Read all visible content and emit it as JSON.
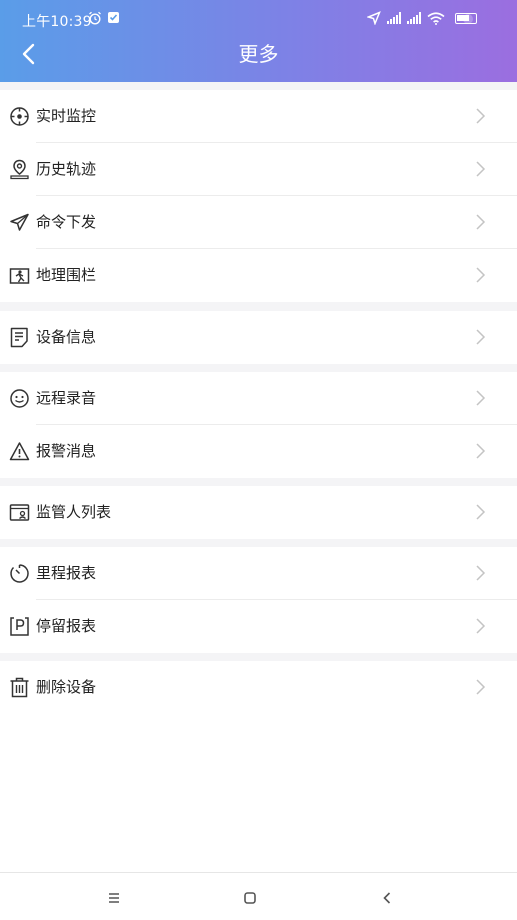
{
  "status_bar": {
    "time": "上午10:39",
    "icons": [
      "alarm-icon",
      "check-app-icon",
      "location-arrow-icon",
      "signal-icon",
      "signal-icon",
      "wifi-icon",
      "battery-icon"
    ]
  },
  "header": {
    "title": "更多",
    "back_icon": "chevron-left-icon",
    "gradient_start": "#5a9de8",
    "gradient_end": "#9b6ee0"
  },
  "groups": [
    {
      "items": [
        {
          "label": "实时监控",
          "icon": "crosshair-icon"
        },
        {
          "label": "历史轨迹",
          "icon": "location-pin-icon"
        },
        {
          "label": "命令下发",
          "icon": "send-icon"
        },
        {
          "label": "地理围栏",
          "icon": "fence-icon"
        }
      ]
    },
    {
      "items": [
        {
          "label": "设备信息",
          "icon": "document-icon"
        }
      ]
    },
    {
      "items": [
        {
          "label": "远程录音",
          "icon": "smile-icon"
        },
        {
          "label": "报警消息",
          "icon": "warning-icon"
        }
      ]
    },
    {
      "items": [
        {
          "label": "监管人列表",
          "icon": "id-card-icon"
        }
      ]
    },
    {
      "items": [
        {
          "label": "里程报表",
          "icon": "timer-icon"
        },
        {
          "label": "停留报表",
          "icon": "parking-icon"
        }
      ]
    },
    {
      "items": [
        {
          "label": "删除设备",
          "icon": "trash-icon"
        }
      ]
    }
  ],
  "bottom_nav": {
    "icons": [
      "menu-icon",
      "home-icon",
      "back-icon"
    ]
  }
}
